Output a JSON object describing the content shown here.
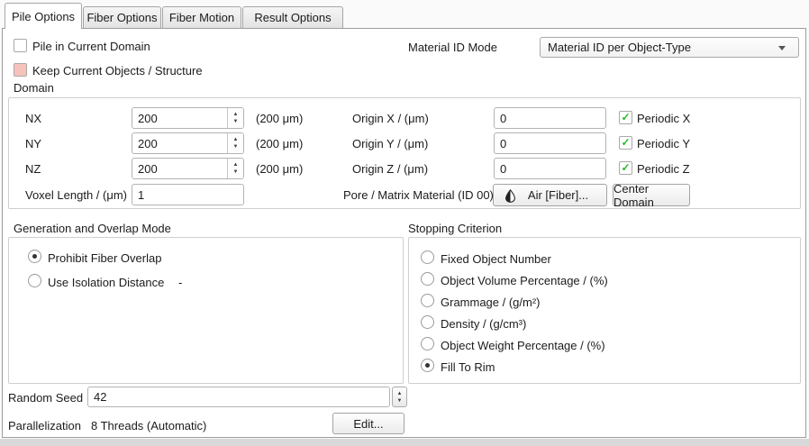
{
  "tabs": [
    {
      "label": "Pile Options",
      "active": true
    },
    {
      "label": "Fiber Options",
      "active": false
    },
    {
      "label": "Fiber Motion",
      "active": false
    },
    {
      "label": "Result Options",
      "active": false
    }
  ],
  "header": {
    "pile_in_current_domain": {
      "label": "Pile in Current Domain",
      "checked": false
    },
    "keep_current_objects": {
      "label": "Keep Current Objects / Structure",
      "state": "highlighted-pink"
    },
    "material_id_mode": {
      "label": "Material ID Mode",
      "value": "Material ID per Object-Type"
    }
  },
  "domain": {
    "title": "Domain",
    "rows": [
      {
        "label": "NX",
        "value": "200",
        "size_hint": "(200 μm)",
        "origin_label": "Origin X / (μm)",
        "origin_value": "0",
        "periodic_label": "Periodic X",
        "periodic_checked": true
      },
      {
        "label": "NY",
        "value": "200",
        "size_hint": "(200 μm)",
        "origin_label": "Origin Y / (μm)",
        "origin_value": "0",
        "periodic_label": "Periodic Y",
        "periodic_checked": true
      },
      {
        "label": "NZ",
        "value": "200",
        "size_hint": "(200 μm)",
        "origin_label": "Origin Z / (μm)",
        "origin_value": "0",
        "periodic_label": "Periodic Z",
        "periodic_checked": true
      }
    ],
    "voxel_length": {
      "label": "Voxel Length / (μm)",
      "value": "1"
    },
    "pore_matrix": {
      "label": "Pore / Matrix Material (ID 00)",
      "material_button": "Air [Fiber]...",
      "center_button": "Center Domain"
    }
  },
  "generation": {
    "title": "Generation and Overlap Mode",
    "options": [
      {
        "label": "Prohibit Fiber Overlap",
        "selected": true
      },
      {
        "label": "Use Isolation Distance",
        "selected": false,
        "value_hint": "-"
      }
    ]
  },
  "stopping": {
    "title": "Stopping Criterion",
    "options": [
      {
        "label": "Fixed Object Number",
        "selected": false
      },
      {
        "label": "Object Volume Percentage / (%)",
        "selected": false
      },
      {
        "label": "Grammage / (g/m²)",
        "selected": false
      },
      {
        "label": "Density / (g/cm³)",
        "selected": false
      },
      {
        "label": "Object Weight Percentage / (%)",
        "selected": false
      },
      {
        "label": "Fill To Rim",
        "selected": true
      }
    ]
  },
  "footer": {
    "random_seed": {
      "label": "Random Seed",
      "value": "42"
    },
    "parallelization": {
      "label": "Parallelization",
      "value": "8 Threads (Automatic)",
      "edit_button": "Edit..."
    }
  },
  "colors": {
    "periodic_check_green": "#28b828",
    "keep_checkbox_fill": "#f6c3ba",
    "panel_border": "#9d9d9d",
    "group_border": "#cfcfcf"
  }
}
